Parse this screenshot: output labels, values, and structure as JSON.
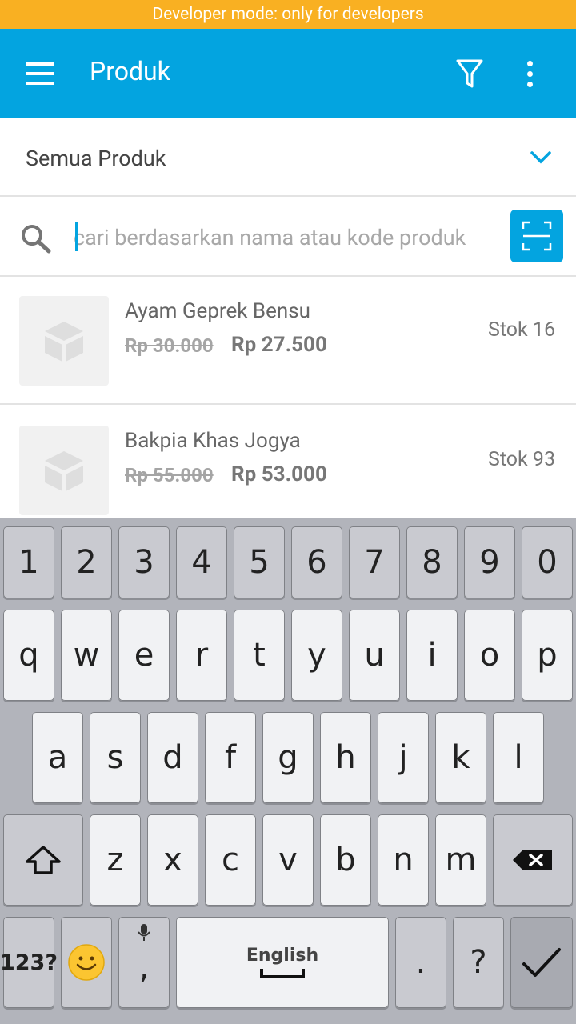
{
  "status_banner": "Developer mode: only for developers",
  "appbar": {
    "title": "Produk",
    "icons": [
      "menu-icon",
      "filter-icon",
      "more-vert-icon"
    ]
  },
  "category": {
    "selected": "Semua Produk"
  },
  "search": {
    "placeholder": "cari berdasarkan nama atau kode produk",
    "value": ""
  },
  "products": [
    {
      "name": "Ayam Geprek Bensu",
      "price_old": "Rp 30.000",
      "price_new": "Rp 27.500",
      "stock": "Stok 16"
    },
    {
      "name": "Bakpia Khas Jogya",
      "price_old": "Rp 55.000",
      "price_new": "Rp 53.000",
      "stock": "Stok 93"
    }
  ],
  "keyboard": {
    "row_numbers": [
      "1",
      "2",
      "3",
      "4",
      "5",
      "6",
      "7",
      "8",
      "9",
      "0"
    ],
    "row1": [
      "q",
      "w",
      "e",
      "r",
      "t",
      "y",
      "u",
      "i",
      "o",
      "p"
    ],
    "row2": [
      "a",
      "s",
      "d",
      "f",
      "g",
      "h",
      "j",
      "k",
      "l"
    ],
    "row3": [
      "z",
      "x",
      "c",
      "v",
      "b",
      "n",
      "m"
    ],
    "symbols_label": "123?",
    "comma": ",",
    "space_label": "English",
    "period": ".",
    "question": "?"
  }
}
